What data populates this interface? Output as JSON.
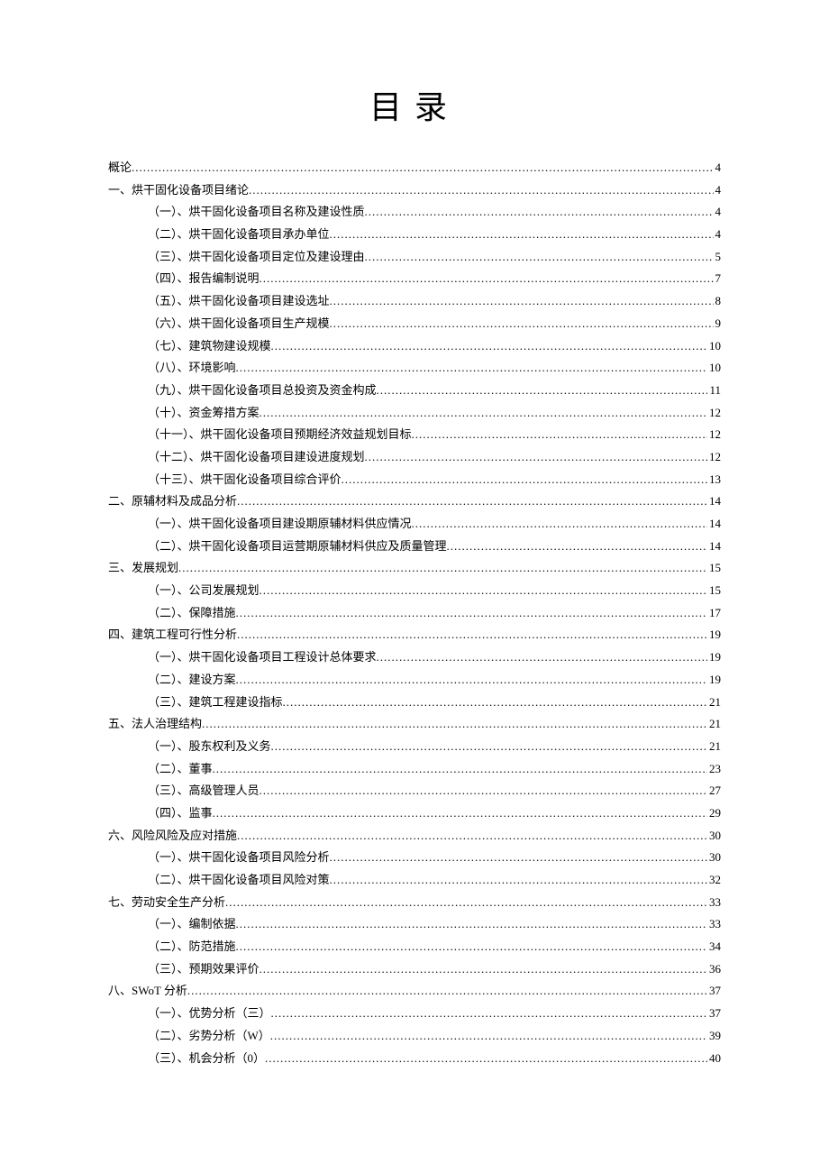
{
  "title": "目录",
  "toc": [
    {
      "level": 0,
      "label": "概论",
      "page": "4"
    },
    {
      "level": 0,
      "label": "一、烘干固化设备项目绪论",
      "page": "4"
    },
    {
      "level": 1,
      "label": "（一）、烘干固化设备项目名称及建设性质",
      "page": "4"
    },
    {
      "level": 1,
      "label": "（二）、烘干固化设备项目承办单位",
      "page": "4"
    },
    {
      "level": 1,
      "label": "（三）、烘干固化设备项目定位及建设理由",
      "page": "5"
    },
    {
      "level": 1,
      "label": "（四）、报告编制说明",
      "page": "7"
    },
    {
      "level": 1,
      "label": "（五）、烘干固化设备项目建设选址",
      "page": "8"
    },
    {
      "level": 1,
      "label": "（六）、烘干固化设备项目生产规模",
      "page": "9"
    },
    {
      "level": 1,
      "label": "（七）、建筑物建设规模",
      "page": "10"
    },
    {
      "level": 1,
      "label": "（八）、环境影响",
      "page": "10"
    },
    {
      "level": 1,
      "label": "（九）、烘干固化设备项目总投资及资金构成",
      "page": "11"
    },
    {
      "level": 1,
      "label": "（十）、资金筹措方案",
      "page": "12"
    },
    {
      "level": 1,
      "label": "（十一）、烘干固化设备项目预期经济效益规划目标",
      "page": "12"
    },
    {
      "level": 1,
      "label": "（十二）、烘干固化设备项目建设进度规划",
      "page": "12"
    },
    {
      "level": 1,
      "label": "（十三）、烘干固化设备项目综合评价",
      "page": "13"
    },
    {
      "level": 0,
      "label": "二、原辅材料及成品分析",
      "page": "14"
    },
    {
      "level": 1,
      "label": "（一）、烘干固化设备项目建设期原辅材料供应情况",
      "page": "14"
    },
    {
      "level": 1,
      "label": "（二）、烘干固化设备项目运营期原辅材料供应及质量管理",
      "page": "14"
    },
    {
      "level": 0,
      "label": "三、发展规划",
      "page": "15"
    },
    {
      "level": 1,
      "label": "（一）、公司发展规划",
      "page": "15"
    },
    {
      "level": 1,
      "label": "（二）、保障措施",
      "page": "17"
    },
    {
      "level": 0,
      "label": "四、建筑工程可行性分析",
      "page": "19"
    },
    {
      "level": 1,
      "label": "（一）、烘干固化设备项目工程设计总体要求",
      "page": "19"
    },
    {
      "level": 1,
      "label": "（二）、建设方案",
      "page": "19"
    },
    {
      "level": 1,
      "label": "（三）、建筑工程建设指标",
      "page": "21"
    },
    {
      "level": 0,
      "label": "五、法人治理结构",
      "page": "21"
    },
    {
      "level": 1,
      "label": "（一）、股东权利及义务",
      "page": "21"
    },
    {
      "level": 1,
      "label": "（二）、董事",
      "page": "23"
    },
    {
      "level": 1,
      "label": "（三）、高级管理人员",
      "page": "27"
    },
    {
      "level": 1,
      "label": "（四）、监事",
      "page": "29"
    },
    {
      "level": 0,
      "label": "六、风险风险及应对措施",
      "page": "30"
    },
    {
      "level": 1,
      "label": "（一）、烘干固化设备项目风险分析",
      "page": "30"
    },
    {
      "level": 1,
      "label": "（二）、烘干固化设备项目风险对策",
      "page": "32"
    },
    {
      "level": 0,
      "label": "七、劳动安全生产分析",
      "page": "33"
    },
    {
      "level": 1,
      "label": "（一）、编制依据",
      "page": "33"
    },
    {
      "level": 1,
      "label": "（二）、防范措施",
      "page": "34"
    },
    {
      "level": 1,
      "label": "（三）、预期效果评价",
      "page": "36"
    },
    {
      "level": 0,
      "label": "八、SWoT 分析",
      "page": "37"
    },
    {
      "level": 1,
      "label": "（一）、优势分析（三）",
      "page": "37"
    },
    {
      "level": 1,
      "label": "（二）、劣势分析（W）",
      "page": "39"
    },
    {
      "level": 1,
      "label": "（三）、机会分析（0）",
      "page": "40"
    }
  ]
}
